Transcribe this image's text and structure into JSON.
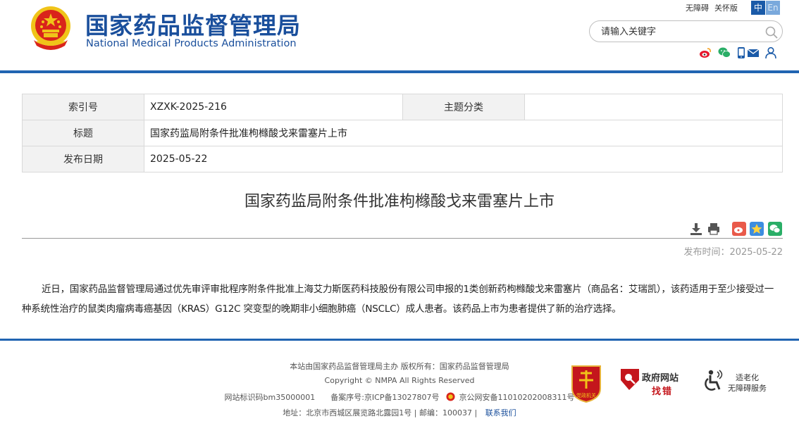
{
  "header": {
    "title_cn": "国家药品监督管理局",
    "title_en": "National Medical Products Administration",
    "top_links": [
      "无障碍",
      "关怀版"
    ],
    "lang_zh": "中",
    "lang_en": "En",
    "search_placeholder": "请输入关键字"
  },
  "info_table": {
    "index_label": "索引号",
    "index_value": "XZXK-2025-216",
    "topic_label": "主题分类",
    "topic_value": "",
    "title_label": "标题",
    "title_value": "国家药监局附条件批准枸橼酸戈来雷塞片上市",
    "date_label": "发布日期",
    "date_value": "2025-05-22"
  },
  "article": {
    "title": "国家药监局附条件批准枸橼酸戈来雷塞片上市",
    "pub_time": "发布时间：2025-05-22",
    "body": "近日，国家药品监督管理局通过优先审评审批程序附条件批准上海艾力斯医药科技股份有限公司申报的1类创新药枸橼酸戈来雷塞片（商品名：艾瑞凯），该药适用于至少接受过一种系统性治疗的鼠类肉瘤病毒癌基因（KRAS）G12C 突变型的晚期非小细胞肺癌（NSCLC）成人患者。该药品上市为患者提供了新的治疗选择。"
  },
  "footer": {
    "line1": "本站由国家药品监督管理局主办 版权所有：国家药品监督管理局",
    "line2": "Copyright © NMPA All Rights Reserved",
    "line3_icp": "网站标识码bm35000001　　备案序号:京ICP备13027807号",
    "line3_police": "京公网安备11010202008311号",
    "line4_address": "地址：北京市西城区展览路北露园1号 | 邮编：100037 |",
    "line4_contact": "联系我们",
    "gov_site_1": "政府网站",
    "gov_site_2": "找错",
    "party_badge": "党政机关",
    "accessibility_1": "适老化",
    "accessibility_2": "无障碍服务"
  },
  "colors": {
    "brand_blue": "#1a4f9c",
    "bar_blue": "#2164b2",
    "emblem_red": "#d9241b",
    "emblem_gold": "#f0c419"
  },
  "icons": [
    "emblem-icon",
    "search-icon",
    "weibo-icon",
    "wechat-icon",
    "mobile-icon",
    "mail-icon",
    "user-icon",
    "download-icon",
    "print-icon",
    "share-weibo-icon",
    "share-qzone-icon",
    "share-wechat-icon",
    "police-icon",
    "party-badge-icon",
    "gov-error-icon",
    "accessibility-icon"
  ]
}
